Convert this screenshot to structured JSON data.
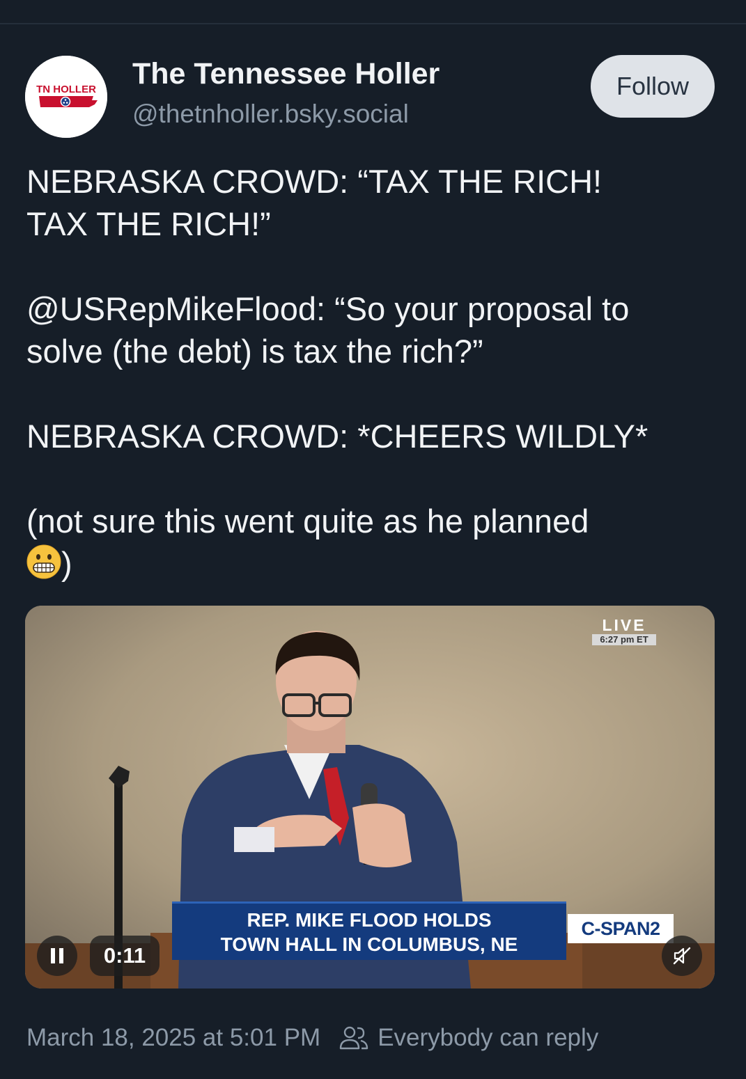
{
  "author": {
    "display_name": "The Tennessee Holler",
    "handle": "@thetnholler.bsky.social",
    "avatar_text": "TN HOLLER"
  },
  "follow_button": {
    "label": "Follow"
  },
  "post": {
    "lines": [
      "NEBRASKA CROWD: “TAX THE RICH!",
      "TAX THE RICH!”",
      "@USRepMikeFlood: “So your proposal to",
      "solve (the debt) is tax the rich?”",
      "NEBRASKA CROWD: *CHEERS WILDLY*",
      "(not sure this went quite as he planned",
      ")"
    ],
    "emoji_name": "grimacing-face"
  },
  "video": {
    "live_label": "LIVE",
    "live_time": "6:27 pm ET",
    "chyron_line1": "REP. MIKE FLOOD HOLDS",
    "chyron_line2": "TOWN HALL IN COLUMBUS, NE",
    "network": "C-SPAN2",
    "elapsed": "0:11",
    "pause_icon": "pause-icon",
    "mute_icon": "muted-speaker-icon"
  },
  "footer": {
    "timestamp": "March 18, 2025 at 5:01 PM",
    "reply_setting": "Everybody can reply",
    "reply_icon": "people-icon"
  },
  "colors": {
    "background": "#161e28",
    "text": "#f1f3f5",
    "muted": "#8d9aa8",
    "follow_bg": "#dfe3e8",
    "chyron_blue": "#143b7e",
    "brand_red": "#c8102e"
  }
}
